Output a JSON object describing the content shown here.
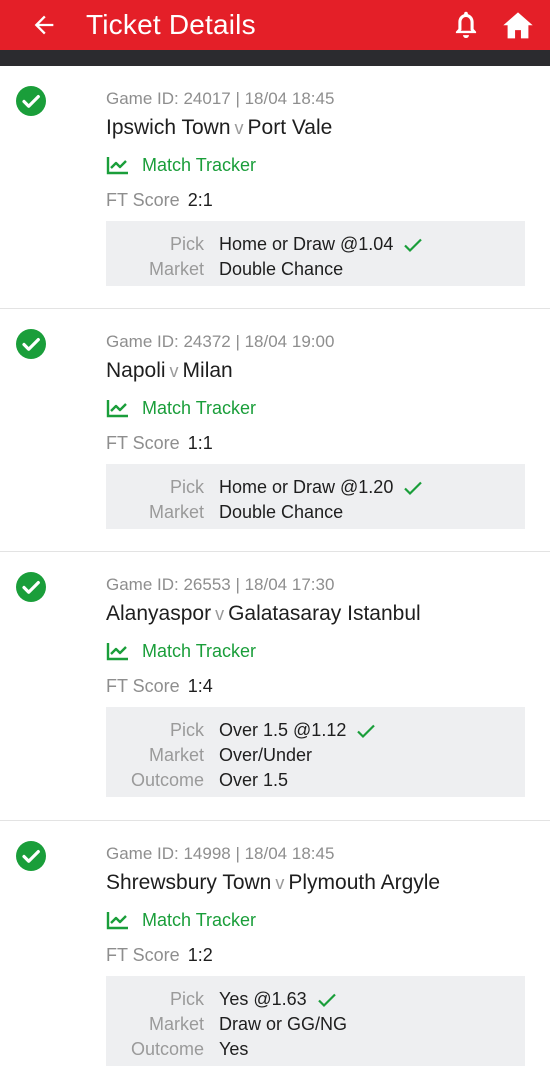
{
  "header": {
    "title": "Ticket Details",
    "icons": [
      "back-arrow-icon",
      "bell-icon",
      "home-icon"
    ]
  },
  "colors": {
    "header": "#e41f28",
    "accent": "#1a9e3a",
    "bar": "#2b2b2f"
  },
  "bets": [
    {
      "game_id": "Game ID: 24017 | 18/04 18:45",
      "home": "Ipswich Town",
      "vs": "v",
      "away": "Port Vale",
      "tracker": "Match Tracker",
      "ft_label": "FT Score",
      "ft_score": "2:1",
      "pick_label": "Pick",
      "pick": "Home or Draw @1.04",
      "market_label": "Market",
      "market": "Double Chance"
    },
    {
      "game_id": "Game ID: 24372 | 18/04 19:00",
      "home": "Napoli",
      "vs": "v",
      "away": "Milan",
      "tracker": "Match Tracker",
      "ft_label": "FT Score",
      "ft_score": "1:1",
      "pick_label": "Pick",
      "pick": "Home or Draw @1.20",
      "market_label": "Market",
      "market": "Double Chance"
    },
    {
      "game_id": "Game ID: 26553 | 18/04 17:30",
      "home": "Alanyaspor",
      "vs": "v",
      "away": "Galatasaray Istanbul",
      "tracker": "Match Tracker",
      "ft_label": "FT Score",
      "ft_score": "1:4",
      "pick_label": "Pick",
      "pick": "Over 1.5 @1.12",
      "market_label": "Market",
      "market": "Over/Under",
      "outcome_label": "Outcome",
      "outcome": "Over 1.5"
    },
    {
      "game_id": "Game ID: 14998 | 18/04 18:45",
      "home": "Shrewsbury Town",
      "vs": "v",
      "away": "Plymouth Argyle",
      "tracker": "Match Tracker",
      "ft_label": "FT Score",
      "ft_score": "1:2",
      "pick_label": "Pick",
      "pick": "Yes @1.63",
      "market_label": "Market",
      "market": "Draw or GG/NG",
      "outcome_label": "Outcome",
      "outcome": "Yes"
    }
  ]
}
